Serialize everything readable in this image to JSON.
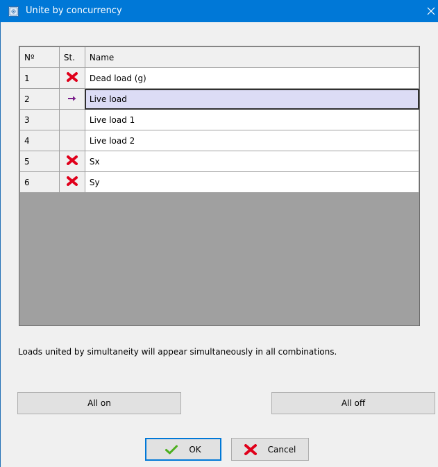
{
  "window": {
    "title": "Unite by concurrency",
    "close_glyph": "✕"
  },
  "grid": {
    "headers": {
      "no": "Nº",
      "status": "St.",
      "name": "Name"
    },
    "rows": [
      {
        "no": "1",
        "status_icon": "red-x-icon",
        "name": "Dead load (g)"
      },
      {
        "no": "2",
        "status_icon": "purple-arrow-icon",
        "name": "Live load"
      },
      {
        "no": "3",
        "status_icon": "",
        "name": "Live load 1"
      },
      {
        "no": "4",
        "status_icon": "",
        "name": "Live load 2"
      },
      {
        "no": "5",
        "status_icon": "red-x-icon",
        "name": "Sx"
      },
      {
        "no": "6",
        "status_icon": "red-x-icon",
        "name": "Sy"
      }
    ],
    "selected_row": 2
  },
  "info_text": "Loads united by simultaneity will appear simultaneously in all combinations.",
  "buttons": {
    "all_on": "All on",
    "all_off": "All off",
    "ok": "OK",
    "cancel": "Cancel"
  },
  "colors": {
    "titlebar": "#0078d7",
    "selected_row": "#dcdcf5",
    "grid_background": "#a0a0a0",
    "red_x": "#e0001b",
    "arrow": "#7a1f8a",
    "ok_check": "#4caf1e"
  }
}
